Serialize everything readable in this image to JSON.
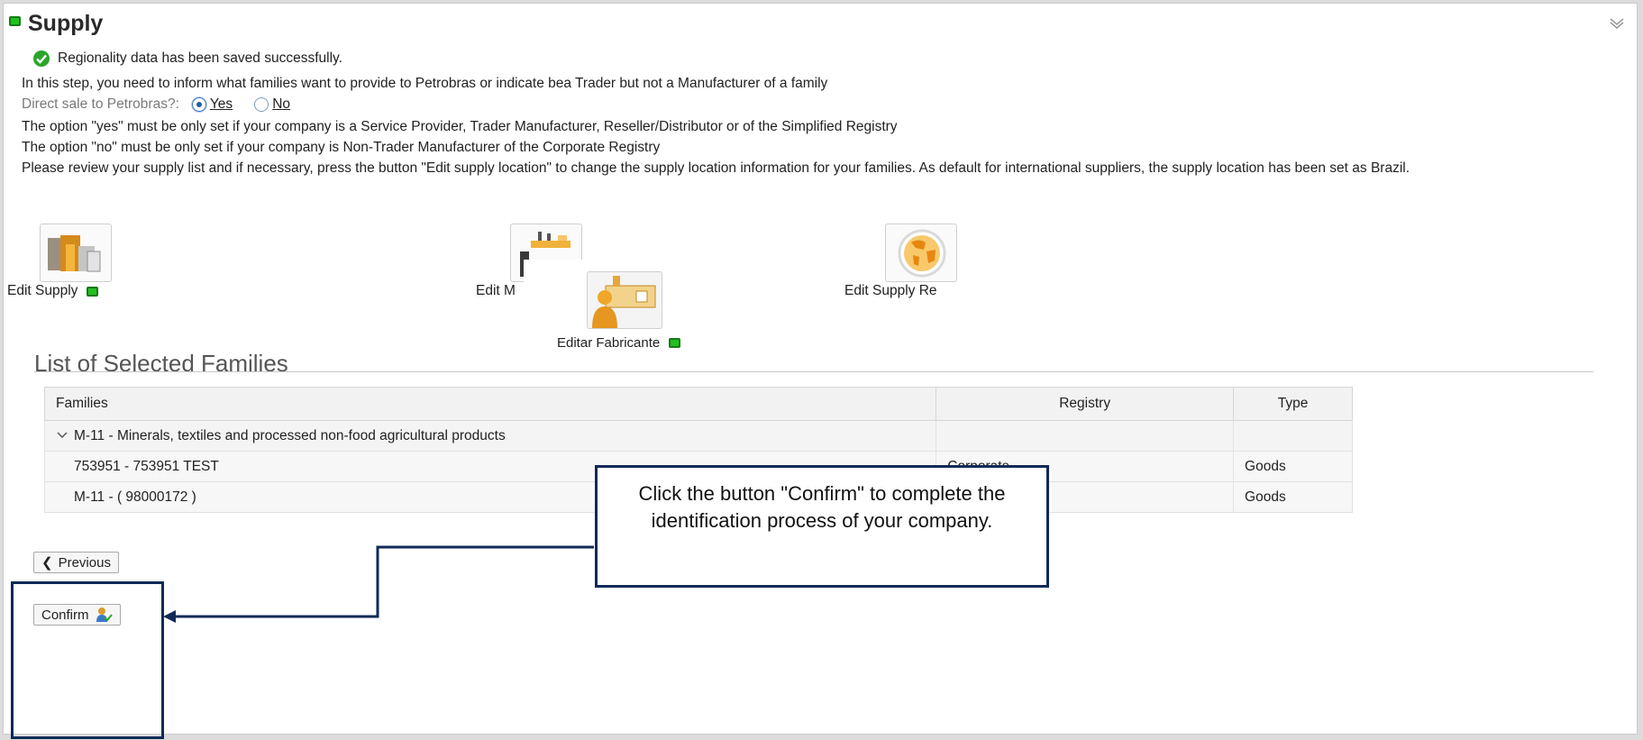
{
  "header": {
    "title": "Supply"
  },
  "success_message": "Regionality data has been saved successfully.",
  "intro": "In this step, you need to inform what families want to provide to Petrobras or indicate bea Trader but not a Manufacturer of a family",
  "direct_sale": {
    "label": "Direct sale to Petrobras?:",
    "options": [
      {
        "label": "Yes",
        "selected": true
      },
      {
        "label": "No",
        "selected": false
      }
    ]
  },
  "notes": {
    "yes": "The option \"yes\" must be only set if your company is a Service Provider, Trader Manufacturer, Reseller/Distributor or of the Simplified Registry",
    "no": "The option \"no\" must be only set if your company is Non-Trader Manufacturer of the Corporate Registry",
    "review": "Please review your supply list and if necessary, press the button \"Edit supply location\" to change the supply location information for your families. As default for international suppliers, the supply location has been set as Brazil."
  },
  "tiles": {
    "edit_supply": "Edit Supply",
    "edit_manufacturer_partial": "Edit M",
    "edit_supply_region_partial": "Edit Supply Re",
    "editar_fabricante": "Editar Fabricante"
  },
  "families": {
    "title": "List of Selected Families",
    "columns": [
      "Families",
      "Registry",
      "Type"
    ],
    "group": "M-11 - Minerals, textiles and processed non-food agricultural products",
    "rows": [
      {
        "family": "753951 - 753951  TEST",
        "registry": "Corporate",
        "type": "Goods"
      },
      {
        "family": "M-11 -  ( 98000172 )",
        "registry": "",
        "type": "Goods"
      }
    ]
  },
  "buttons": {
    "previous": "Previous",
    "confirm": "Confirm"
  },
  "callout": "Click the button \"Confirm\" to complete the identification process of your company.",
  "colors": {
    "status_green": "#20c020",
    "annotation_navy": "#0f2a57",
    "success_icon": "#2aa52a"
  }
}
